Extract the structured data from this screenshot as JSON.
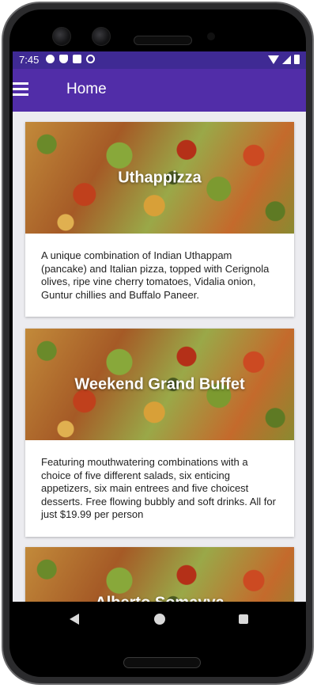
{
  "status_bar": {
    "time": "7:45",
    "left_icons": [
      "gear-icon",
      "shield-icon",
      "sd-card-icon",
      "sync-icon"
    ],
    "right_icons": [
      "wifi-icon",
      "signal-icon",
      "battery-icon"
    ]
  },
  "app_bar": {
    "title": "Home",
    "menu_icon": "hamburger-menu-icon",
    "color": "#512da8",
    "status_color": "#3f2a94"
  },
  "cards": [
    {
      "title": "Uthappizza",
      "description": "A unique combination of Indian Uthappam (pancake) and Italian pizza, topped with Cerignola olives, ripe vine cherry tomatoes, Vidalia onion, Guntur chillies and Buffalo Paneer."
    },
    {
      "title": "Weekend Grand Buffet",
      "description": "Featuring mouthwatering combinations with a choice of five different salads, six enticing appetizers, six main entrees and five choicest desserts. Free flowing bubbly and soft drinks. All for just $19.99 per person"
    },
    {
      "title": "Alberto Somayya",
      "description": ""
    }
  ],
  "nav_bar": {
    "buttons": [
      "back-icon",
      "home-icon",
      "recents-icon"
    ]
  }
}
